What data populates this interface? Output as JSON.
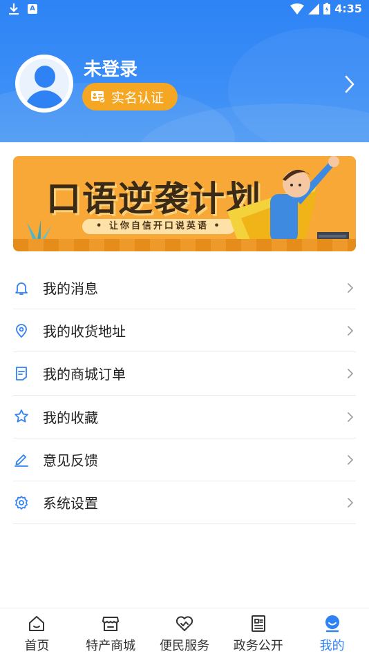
{
  "status_bar": {
    "time": "4:35",
    "notification_a": "A"
  },
  "profile": {
    "name": "未登录",
    "verify_label": "实名认证"
  },
  "banner": {
    "title": "口语逆袭计划",
    "subtitle": "• 让你自信开口说英语 •"
  },
  "menu": {
    "items": [
      {
        "label": "我的消息",
        "icon": "bell-icon"
      },
      {
        "label": "我的收货地址",
        "icon": "location-pin-icon"
      },
      {
        "label": "我的商城订单",
        "icon": "document-icon"
      },
      {
        "label": "我的收藏",
        "icon": "star-icon"
      },
      {
        "label": "意见反馈",
        "icon": "edit-pen-icon"
      },
      {
        "label": "系统设置",
        "icon": "gear-icon"
      }
    ]
  },
  "bottom_nav": {
    "items": [
      {
        "label": "首页",
        "icon": "home-icon"
      },
      {
        "label": "特产商城",
        "icon": "store-icon"
      },
      {
        "label": "便民服务",
        "icon": "handshake-heart-icon"
      },
      {
        "label": "政务公开",
        "icon": "newspaper-icon"
      },
      {
        "label": "我的",
        "icon": "user-face-icon"
      }
    ],
    "active_index": 4
  },
  "colors": {
    "primary": "#2f82f4",
    "verify_orange": "#f5a623",
    "banner_orange": "#f7a836"
  }
}
